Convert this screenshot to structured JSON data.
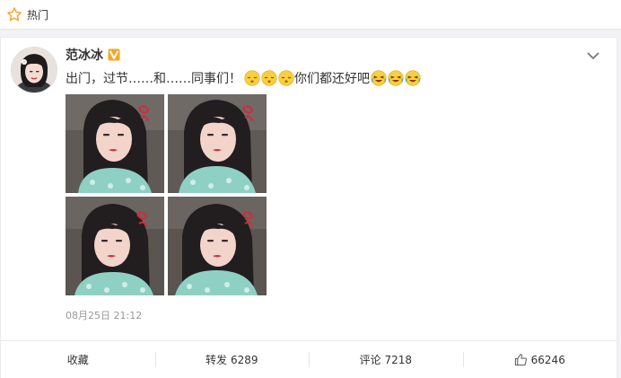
{
  "header": {
    "title": "热门"
  },
  "post": {
    "author": "范冰冰",
    "text_main": "出门，过节……和……同事们！",
    "text_tail": "你们都还好吧",
    "timestamp": "08月25日 21:12"
  },
  "actions": {
    "favorite_label": "收藏",
    "repost_label": "转发",
    "repost_count": "6289",
    "comment_label": "评论",
    "comment_count": "7218",
    "like_count": "66246"
  },
  "colors": {
    "accent_orange": "#f7a11d",
    "verified_orange": "#f6a623",
    "emoji_yellow": "#f9cf3b"
  },
  "icons": {
    "header": "star-outline-icon",
    "verified": "verified-v-icon",
    "menu": "chevron-down-icon",
    "like": "thumbs-up-icon"
  }
}
